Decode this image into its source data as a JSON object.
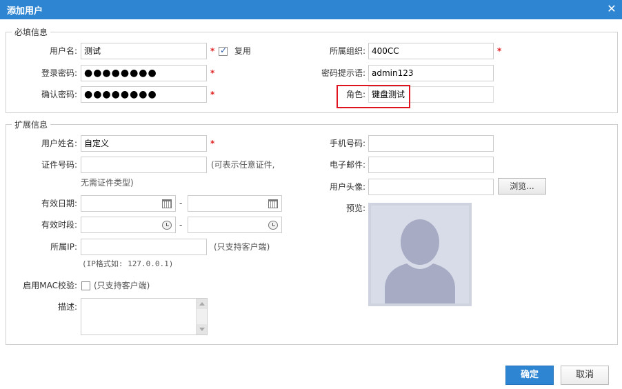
{
  "dialog": {
    "title": "添加用户"
  },
  "required": {
    "legend": "必填信息",
    "username": {
      "label": "用户名:",
      "value": "测试"
    },
    "reuse_label": "复用",
    "password": {
      "label": "登录密码:",
      "value": "●●●●●●●●"
    },
    "confirm": {
      "label": "确认密码:",
      "value": "●●●●●●●●"
    },
    "org": {
      "label": "所属组织:",
      "value": "400CC"
    },
    "hint": {
      "label": "密码提示语:",
      "value": "admin123"
    },
    "role": {
      "label": "角色:",
      "value": "键盘测试"
    },
    "star": "*"
  },
  "extended": {
    "legend": "扩展信息",
    "realname": {
      "label": "用户姓名:",
      "value": "自定义"
    },
    "idnum": {
      "label": "证件号码:",
      "value": "",
      "hint1": "(可表示任意证件,",
      "hint2": "无需证件类型)"
    },
    "validdate": {
      "label": "有效日期:",
      "dash": "-"
    },
    "validtime": {
      "label": "有效时段:",
      "dash": "-"
    },
    "ip": {
      "label": "所属IP:",
      "hint": "(只支持客户端)",
      "format_hint": "(IP格式如: 127.0.0.1)"
    },
    "mac": {
      "label": "启用MAC校验:",
      "hint": "(只支持客户端)"
    },
    "desc": {
      "label": "描述:"
    },
    "mobile": {
      "label": "手机号码:"
    },
    "email": {
      "label": "电子邮件:"
    },
    "avatar": {
      "label": "用户头像:",
      "browse": "浏览..."
    },
    "preview": {
      "label": "预览:"
    }
  },
  "footer": {
    "ok": "确定",
    "cancel": "取消"
  },
  "colors": {
    "accent": "#2e86d3",
    "required_star": "#e02020",
    "highlight": "#e0141e",
    "avatar_bg": "#d8dbe8",
    "avatar_fg": "#a7acc4"
  },
  "icons": [
    "close-icon",
    "check-icon",
    "calendar-icon",
    "clock-icon",
    "avatar-placeholder-icon"
  ]
}
